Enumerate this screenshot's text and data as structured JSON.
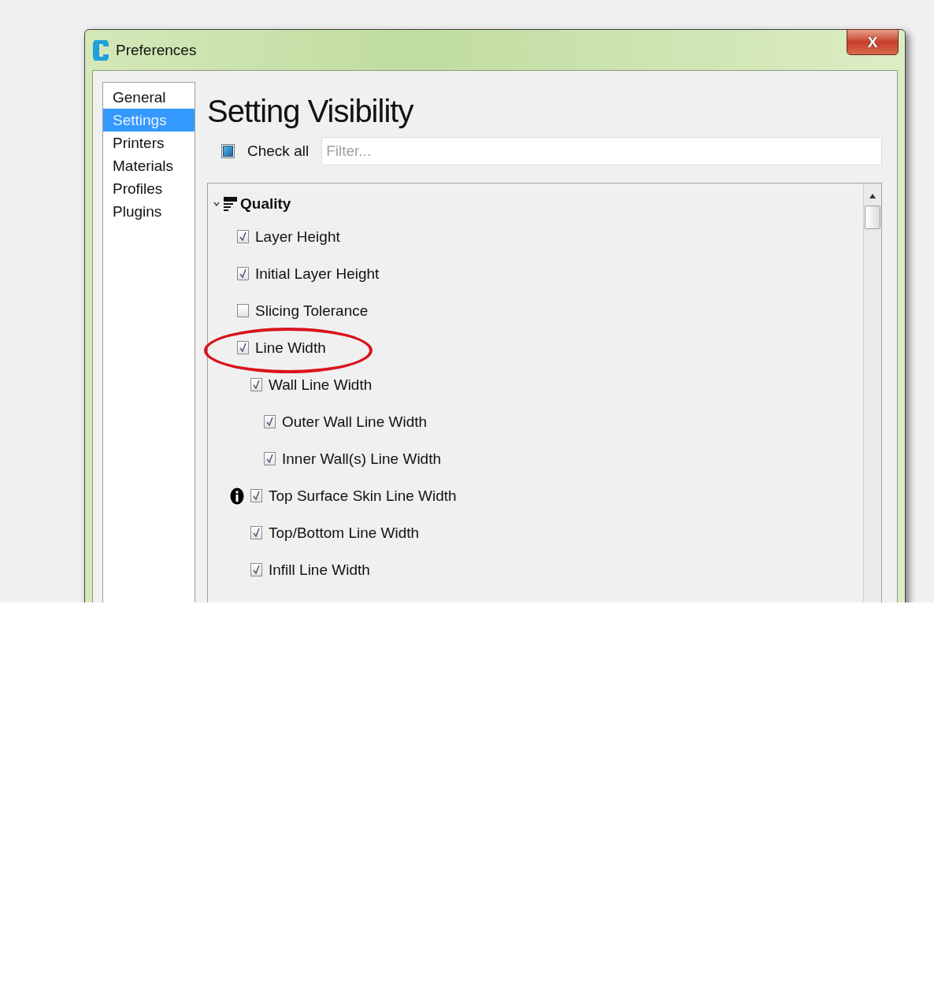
{
  "window": {
    "title": "Preferences",
    "close_label": "X"
  },
  "sidebar": {
    "items": [
      {
        "label": "General",
        "selected": false
      },
      {
        "label": "Settings",
        "selected": true
      },
      {
        "label": "Printers",
        "selected": false
      },
      {
        "label": "Materials",
        "selected": false
      },
      {
        "label": "Profiles",
        "selected": false
      },
      {
        "label": "Plugins",
        "selected": false
      }
    ]
  },
  "page": {
    "title": "Setting Visibility",
    "check_all": {
      "label": "Check all",
      "checked": false,
      "partial": true
    },
    "filter": {
      "placeholder": "Filter..."
    }
  },
  "tree": [
    {
      "label": "Quality",
      "kind": "category",
      "expanded": true,
      "children": [
        {
          "label": "Layer Height",
          "kind": "setting",
          "checked": true
        },
        {
          "label": "Initial Layer Height",
          "kind": "setting",
          "checked": true
        },
        {
          "label": "Slicing Tolerance",
          "kind": "setting",
          "checked": false
        },
        {
          "label": "Line Width",
          "kind": "setting",
          "checked": true,
          "highlighted": true,
          "children": [
            {
              "label": "Wall Line Width",
              "kind": "setting",
              "checked": true,
              "children": [
                {
                  "label": "Outer Wall Line Width",
                  "kind": "setting",
                  "checked": true
                },
                {
                  "label": "Inner Wall(s) Line Width",
                  "kind": "setting",
                  "checked": true
                }
              ]
            },
            {
              "label": "Top Surface Skin Line Width",
              "kind": "setting",
              "checked": true,
              "info": true
            },
            {
              "label": "Top/Bottom Line Width",
              "kind": "setting",
              "checked": true
            },
            {
              "label": "Infill Line Width",
              "kind": "setting",
              "checked": true
            }
          ]
        }
      ]
    }
  ]
}
